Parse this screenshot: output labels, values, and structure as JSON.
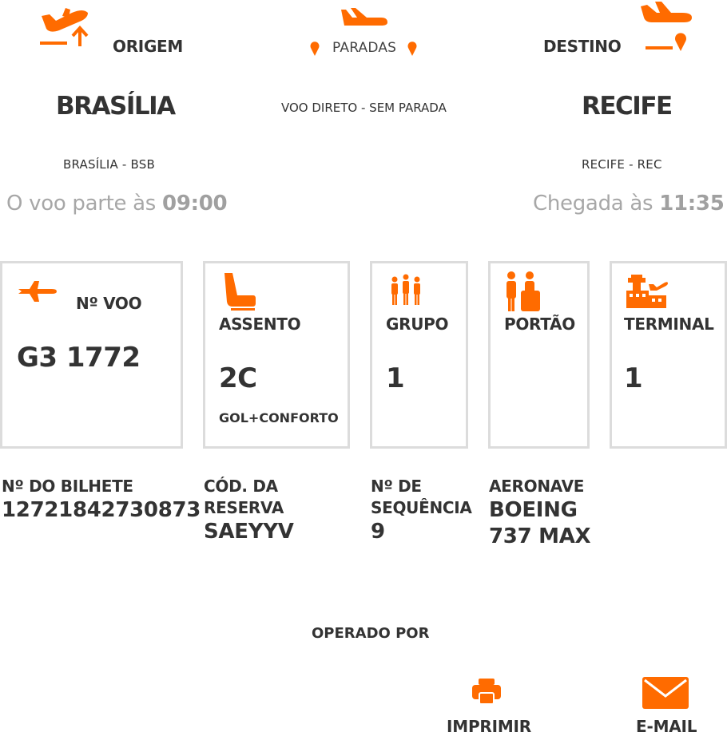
{
  "header": {
    "origin_label": "ORIGEM",
    "stops_label": "PARADAS",
    "destination_label": "DESTINO"
  },
  "route": {
    "origin_city": "BRASÍLIA",
    "origin_airport": "BRASÍLIA - BSB",
    "flight_type": "VOO DIRETO - SEM PARADA",
    "destination_city": "RECIFE",
    "destination_airport": "RECIFE - REC",
    "departure_prefix": "O voo parte às",
    "departure_time": "09:00",
    "arrival_prefix": "Chegada às",
    "arrival_time": "11:35"
  },
  "cards": {
    "flight": {
      "title": "Nº VOO",
      "value": "G3 1772",
      "icon": "airplane-icon"
    },
    "seat": {
      "title": "ASSENTO",
      "value": "2C",
      "sub": "GOL+CONFORTO",
      "icon": "seat-icon"
    },
    "group": {
      "title": "GRUPO",
      "value": "1",
      "icon": "people-group-icon"
    },
    "gate": {
      "title": "PORTÃO",
      "value": "",
      "icon": "gate-passenger-icon"
    },
    "terminal": {
      "title": "TERMINAL",
      "value": "1",
      "icon": "terminal-building-icon"
    }
  },
  "details": {
    "ticket": {
      "label": "Nº DO BILHETE",
      "value": "12721842730873"
    },
    "booking_line1": "CÓD. DA",
    "booking_line2": "RESERVA",
    "booking_value": "SAEYYV",
    "sequence_line1": "Nº DE",
    "sequence_line2": "SEQUÊNCIA",
    "sequence_value": "9",
    "aircraft_label": "AERONAVE",
    "aircraft_line1": "BOEING",
    "aircraft_line2": "737 MAX"
  },
  "operated_by_label": "OPERADO POR",
  "actions": {
    "print_label": "IMPRIMIR",
    "email_label": "E-MAIL"
  },
  "colors": {
    "accent": "#ff6b00",
    "card_border": "#dcdcdc",
    "muted_text": "#a7a7a7"
  }
}
